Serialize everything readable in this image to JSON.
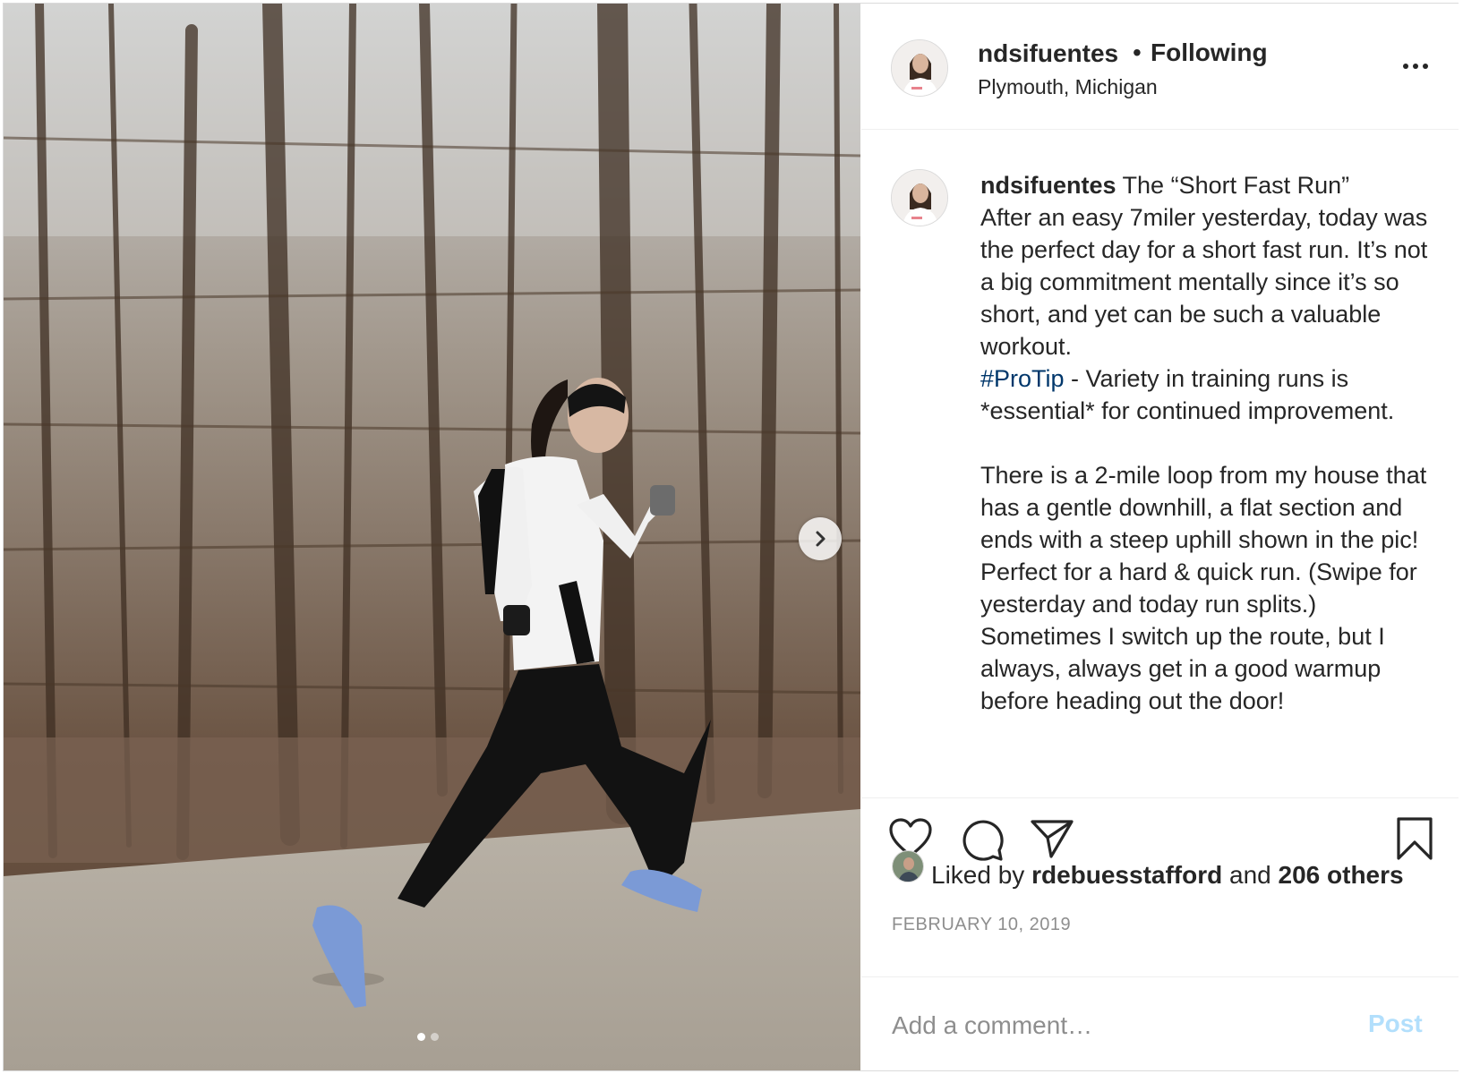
{
  "header": {
    "username": "ndsifuentes",
    "separator": "•",
    "follow_status": "Following",
    "location": "Plymouth, Michigan",
    "more_icon": "more-horizontal-icon"
  },
  "media": {
    "next_icon": "chevron-right-icon",
    "slide_count": 2,
    "active_slide": 1
  },
  "caption": {
    "username": "ndsifuentes",
    "text_before_tag": " The “Short Fast Run”\nAfter an easy 7miler yesterday, today was the perfect day for a short fast run. It’s not a big commitment mentally since it’s so short, and yet can be such a valuable workout.\n",
    "hashtag": "#ProTip",
    "text_after_tag": " - Variety in training runs is *essential* for continued improvement.\n\nThere is a 2-mile loop from my house that has a gentle downhill, a flat section and ends with a steep uphill shown in the pic! Perfect for a hard & quick run. (Swipe for yesterday and today run splits.) Sometimes I switch up the route, but I always, always get in a good warmup before heading out the door!"
  },
  "actions": {
    "like_icon": "heart-icon",
    "comment_icon": "comment-bubble-icon",
    "share_icon": "paper-plane-icon",
    "save_icon": "bookmark-icon"
  },
  "likes": {
    "prefix": "Liked by ",
    "user": "rdebuesstafford",
    "middle": " and ",
    "others": "206 others"
  },
  "date": "FEBRUARY 10, 2019",
  "comment": {
    "placeholder": "Add a comment…",
    "post_label": "Post"
  },
  "colors": {
    "hashtag": "#00376b",
    "post_button_disabled": "#b2dffc",
    "secondary_text": "#8e8e8e"
  }
}
